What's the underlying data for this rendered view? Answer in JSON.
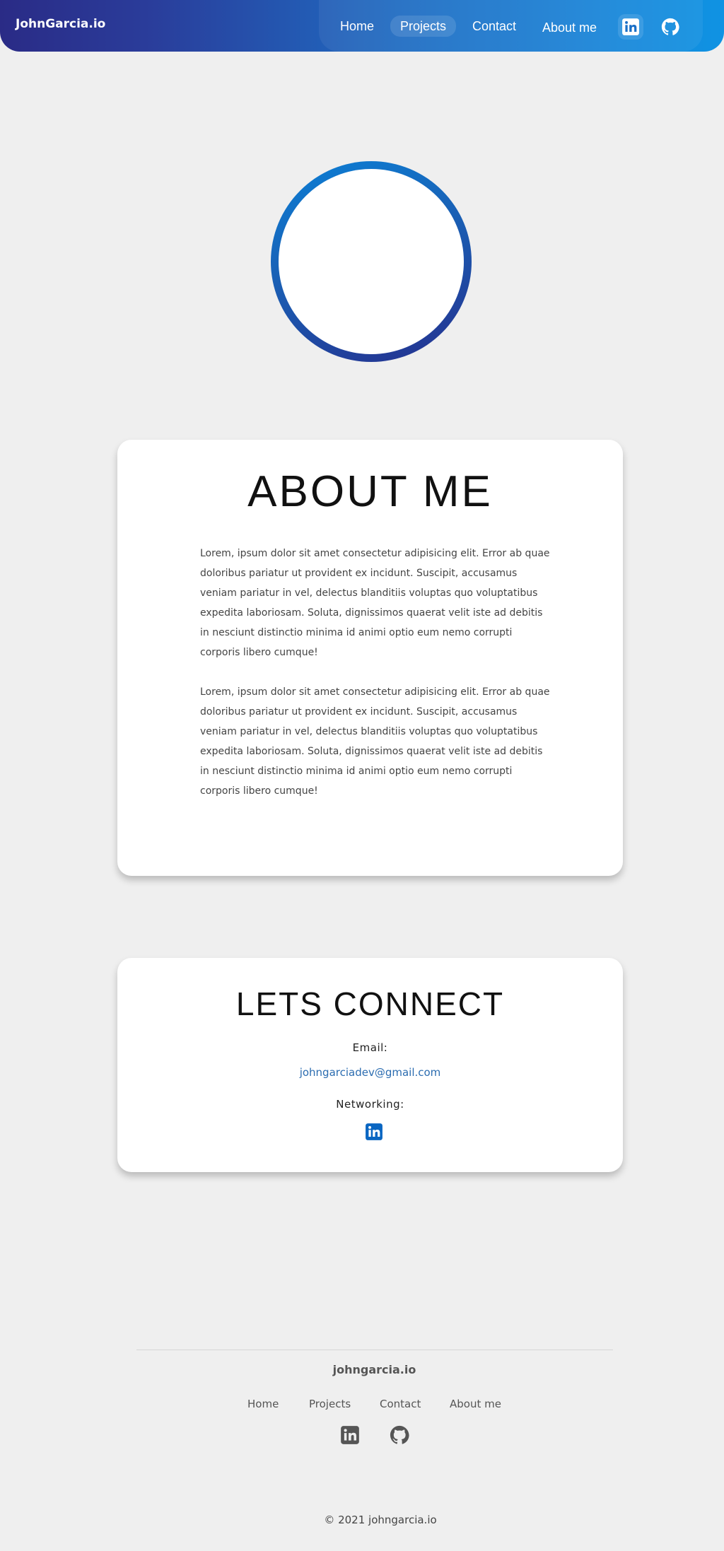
{
  "header": {
    "brand": "JohnGarcia.io",
    "nav": [
      {
        "label": "Home"
      },
      {
        "label": "Projects"
      },
      {
        "label": "Contact"
      },
      {
        "label": "About me"
      }
    ],
    "icons": [
      "linkedin-icon",
      "github-icon"
    ]
  },
  "avatar": {
    "ring_colors": [
      "#0b80d6",
      "#25308e"
    ]
  },
  "about": {
    "title": "ABOUT ME",
    "paragraphs": [
      "Lorem, ipsum dolor sit amet consectetur adipisicing elit. Error ab quae doloribus pariatur ut provident ex incidunt. Suscipit, accusamus veniam pariatur in vel, delectus blanditiis voluptas quo voluptatibus expedita laboriosam. Soluta, dignissimos quaerat velit iste ad debitis in nesciunt distinctio minima id animi optio eum nemo corrupti corporis libero cumque!",
      "Lorem, ipsum dolor sit amet consectetur adipisicing elit. Error ab quae doloribus pariatur ut provident ex incidunt. Suscipit, accusamus veniam pariatur in vel, delectus blanditiis voluptas quo voluptatibus expedita laboriosam. Soluta, dignissimos quaerat velit iste ad debitis in nesciunt distinctio minima id animi optio eum nemo corrupti corporis libero cumque!"
    ]
  },
  "connect": {
    "title": "LETS CONNECT",
    "email_label": "Email:",
    "email": "johngarciadev@gmail.com",
    "networking_label": "Networking:",
    "networking_icon": "linkedin-icon",
    "link_color": "#2b6cb0",
    "linkedin_color": "#0a66c2"
  },
  "footer": {
    "brand": "johngarcia.io",
    "links": [
      {
        "label": "Home"
      },
      {
        "label": "Projects"
      },
      {
        "label": "Contact"
      },
      {
        "label": "About me"
      }
    ],
    "icons": [
      "linkedin-icon",
      "github-icon"
    ],
    "copyright": "© 2021 johngarcia.io"
  },
  "colors": {
    "header_gradient_start": "#2a2b86",
    "header_gradient_end": "#0f93e3",
    "background": "#efefef"
  }
}
